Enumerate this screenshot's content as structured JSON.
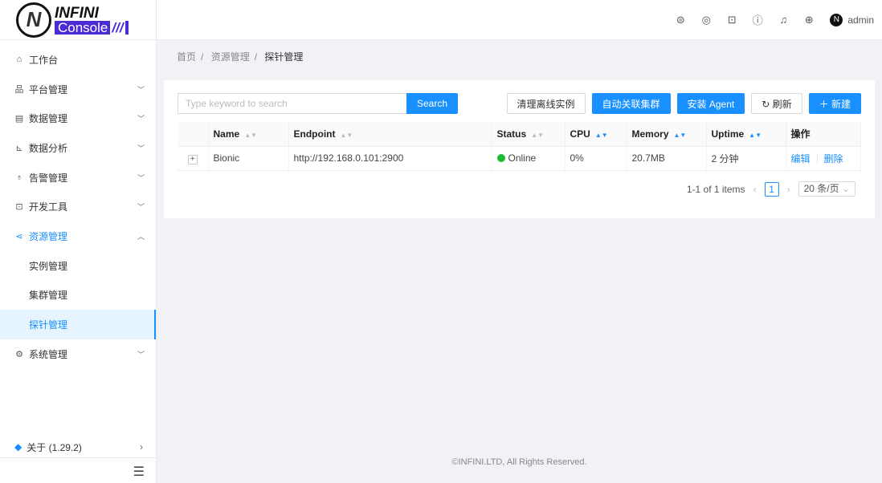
{
  "logo": {
    "text1": "INFINI",
    "text2": "Console",
    "mark": "N"
  },
  "sidebar": {
    "items": [
      {
        "label": "工作台",
        "icon": "home-icon",
        "chev": ""
      },
      {
        "label": "平台管理",
        "icon": "cluster-icon",
        "chev": "⌄"
      },
      {
        "label": "数据管理",
        "icon": "database-icon",
        "chev": "⌄"
      },
      {
        "label": "数据分析",
        "icon": "chart-icon",
        "chev": "⌄"
      },
      {
        "label": "告警管理",
        "icon": "alarm-icon",
        "chev": "⌄"
      },
      {
        "label": "开发工具",
        "icon": "code-icon",
        "chev": "⌄"
      },
      {
        "label": "资源管理",
        "icon": "share-icon",
        "chev": "⌃"
      },
      {
        "label": "实例管理"
      },
      {
        "label": "集群管理"
      },
      {
        "label": "探针管理"
      },
      {
        "label": "系统管理",
        "icon": "gear-icon",
        "chev": "⌄"
      }
    ],
    "about": "关于 (1.29.2)"
  },
  "header": {
    "user": "admin"
  },
  "breadcrumb": [
    "首页",
    "资源管理",
    "探针管理"
  ],
  "search": {
    "placeholder": "Type keyword to search",
    "button": "Search"
  },
  "toolbar": {
    "clean": "清理离线实例",
    "auto": "自动关联集群",
    "install": "安装 Agent",
    "refresh": "刷新",
    "new": "新建"
  },
  "table": {
    "columns": [
      "Name",
      "Endpoint",
      "Status",
      "CPU",
      "Memory",
      "Uptime",
      "操作"
    ],
    "rows": [
      {
        "name": "Bionic",
        "endpoint": "http://192.168.0.101:2900",
        "status": "Online",
        "cpu": "0%",
        "memory": "20.7MB",
        "uptime": "2 分钟",
        "edit": "编辑",
        "delete": "删除"
      }
    ]
  },
  "pagination": {
    "summary": "1-1 of 1 items",
    "page": "1",
    "size": "20 条/页"
  },
  "footer": "©INFINI.LTD, All Rights Reserved.",
  "colors": {
    "primary": "#1890ff",
    "online": "#1fbb34",
    "brand": "#4b2bd6"
  }
}
